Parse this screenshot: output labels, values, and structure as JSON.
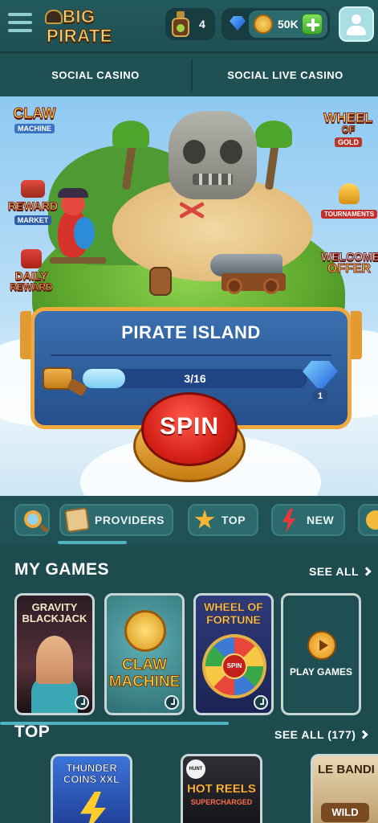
{
  "header": {
    "logo_line1": "BIG",
    "logo_line2": "PIRATE",
    "potion_count": "4",
    "coin_balance": "50K"
  },
  "top_tabs": [
    {
      "label": "SOCIAL CASINO"
    },
    {
      "label": "SOCIAL LIVE CASINO"
    }
  ],
  "hero": {
    "features": {
      "claw_machine": {
        "line1": "CLAW",
        "line2": "MACHINE"
      },
      "wheel_of_gold": {
        "line1": "WHEEL",
        "line2": "OF",
        "line3": "GOLD"
      },
      "reward_market": {
        "line1": "REWARD",
        "line2": "MARKET"
      },
      "tournaments": {
        "label": "TOURNAMENTS"
      },
      "daily_reward": {
        "line1": "DAILY",
        "line2": "REWARD"
      },
      "welcome_offer": {
        "line1": "WELCOME",
        "line2": "OFFER"
      }
    },
    "banner_title": "PIRATE ISLAND",
    "progress_text": "3/16",
    "progress_fraction": 0.1875,
    "diamond_reward": "1",
    "spin_label": "SPIN"
  },
  "categories": [
    {
      "label": "PROVIDERS",
      "icon": "scroll-icon"
    },
    {
      "label": "TOP",
      "icon": "star-icon"
    },
    {
      "label": "NEW",
      "icon": "bolt-icon"
    }
  ],
  "my_games": {
    "title": "MY GAMES",
    "see_all": "SEE ALL",
    "games": [
      {
        "line1": "GRAVITY",
        "line2": "BLACKJACK"
      },
      {
        "line1": "CLAW",
        "line2": "MACHINE"
      },
      {
        "line1": "WHEEL OF",
        "line2": "FORTUNE",
        "center": "SPIN"
      },
      {
        "label": "PLAY GAMES"
      }
    ]
  },
  "top_section": {
    "title": "TOP",
    "see_all": "SEE ALL (177)",
    "games": [
      {
        "line1": "THUNDER",
        "line2": "COINS XXL"
      },
      {
        "badge": "HUNT",
        "line1": "HOT REELS",
        "line2": "SUPERCHARGED"
      },
      {
        "line1": "LE BANDI",
        "sub": "WILD"
      }
    ]
  }
}
